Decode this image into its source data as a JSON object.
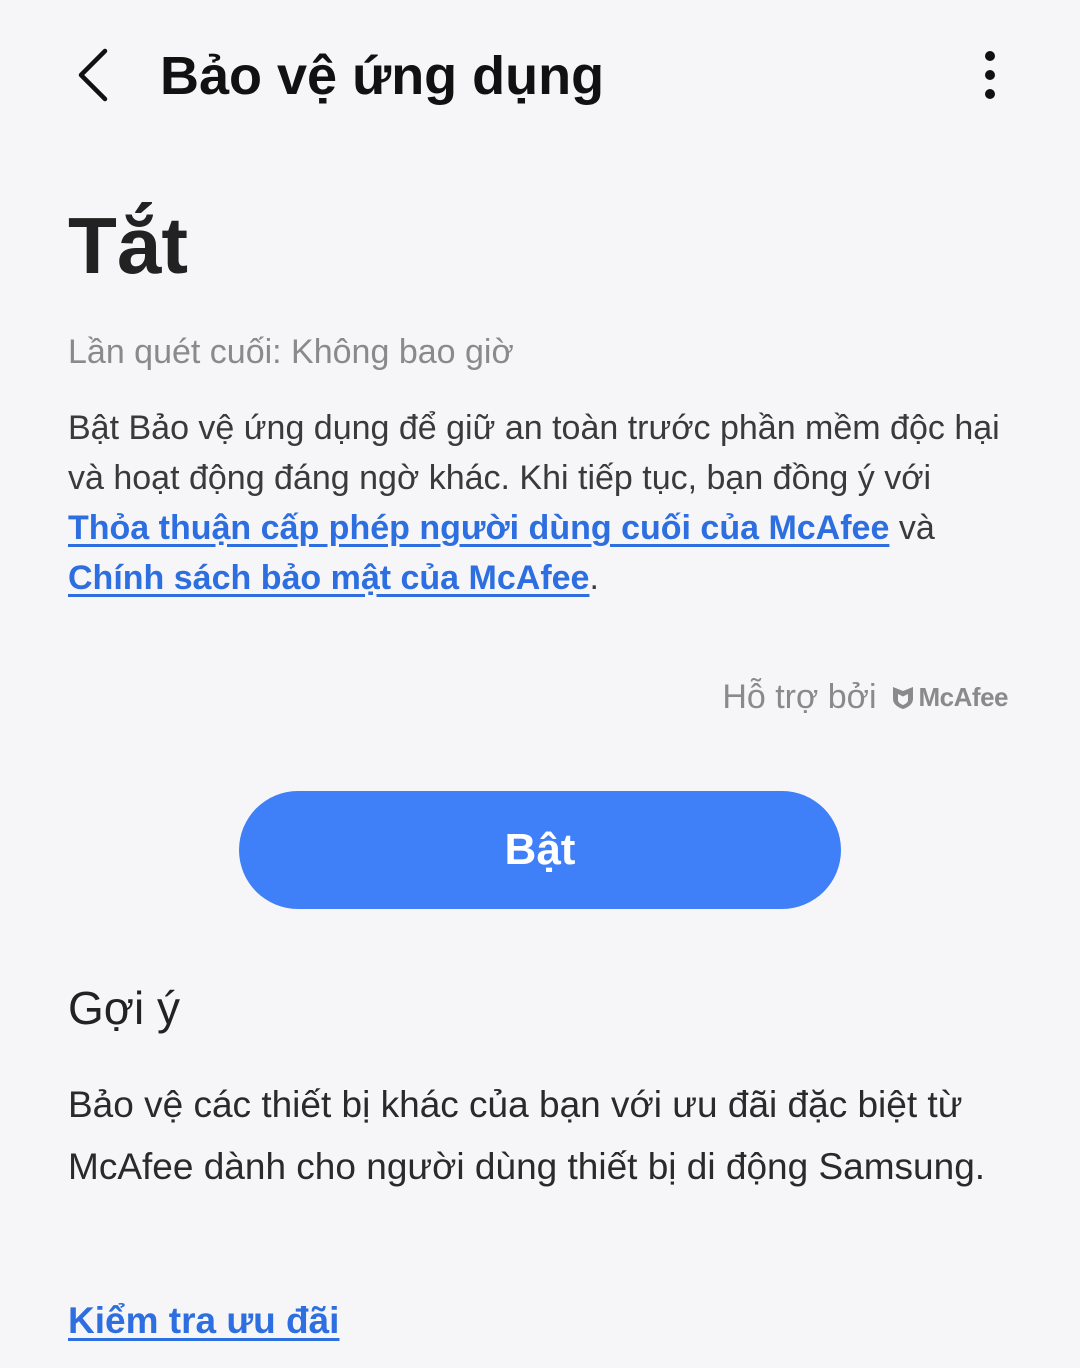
{
  "header": {
    "title": "Bảo vệ ứng dụng",
    "back_icon": "chevron-left-icon",
    "more_icon": "more-vertical-icon"
  },
  "status": {
    "title": "Tắt",
    "last_scan": "Lần quét cuối: Không bao giờ"
  },
  "description": {
    "text": "Bật Bảo vệ ứng dụng để giữ an toàn trước phần mềm độc hại và hoạt động đáng ngờ khác. Khi tiếp tục, bạn đồng ý với",
    "eula_link": "Thỏa thuận cấp phép người dùng cuối của McAfee",
    "conjunction": " và",
    "privacy_link": "Chính sách bảo mật của McAfee",
    "period": "."
  },
  "powered_by": {
    "label": "Hỗ trợ bởi",
    "brand": "McAfee",
    "brand_icon": "mcafee-shield-icon"
  },
  "primary_button": {
    "label": "Bật"
  },
  "suggestion": {
    "title": "Gợi ý",
    "text": "Bảo vệ các thiết bị khác của bạn với ưu đãi đặc biệt từ McAfee dành cho người dùng thiết bị di động Samsung.",
    "link": "Kiểm tra ưu đãi"
  },
  "colors": {
    "background": "#f6f6f8",
    "accent": "#3f7ff7",
    "link": "#2d6ee0",
    "secondary_text": "#8a8a8a"
  }
}
